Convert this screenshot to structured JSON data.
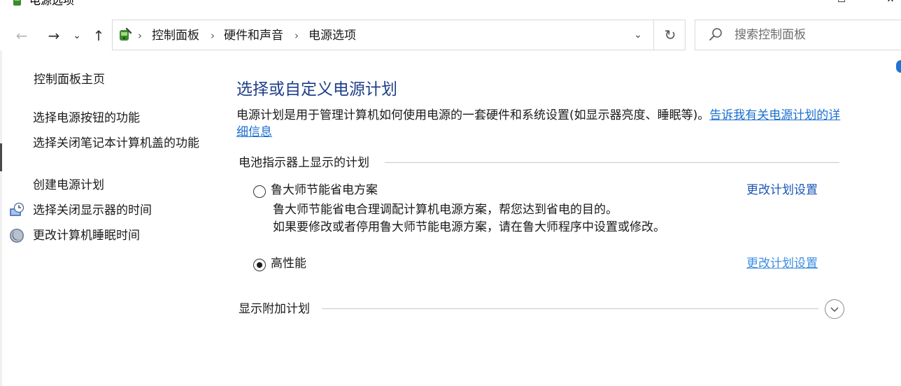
{
  "window": {
    "title": "电源选项",
    "minimize_glyph": "—",
    "maximize_glyph": "☐",
    "close_glyph": "✕"
  },
  "nav": {
    "back_glyph": "←",
    "forward_glyph": "→",
    "recent_glyph": "⌄",
    "up_glyph": "↑",
    "dropdown_glyph": "⌄",
    "refresh_glyph": "↻",
    "breadcrumb": [
      "控制面板",
      "硬件和声音",
      "电源选项"
    ],
    "separator": "›"
  },
  "search": {
    "placeholder": "搜索控制面板",
    "value": ""
  },
  "sidebar": {
    "home_label": "控制面板主页",
    "items": [
      {
        "label": "选择电源按钮的功能",
        "icon": ""
      },
      {
        "label": "选择关闭笔记本计算机盖的功能",
        "icon": ""
      },
      {
        "label": "创建电源计划",
        "icon": ""
      },
      {
        "label": "选择关闭显示器的时间",
        "icon": "monitor-clock-icon"
      },
      {
        "label": "更改计算机睡眠时间",
        "icon": "moon-icon"
      }
    ]
  },
  "main": {
    "title": "选择或自定义电源计划",
    "description": "电源计划是用于管理计算机如何使用电源的一套硬件和系统设置(如显示器亮度、睡眠等)。",
    "description_link": "告诉我有关电源计划的详细信息",
    "battery_group_label": "电池指示器上显示的计划",
    "plans": [
      {
        "name": "鲁大师节能省电方案",
        "selected": false,
        "desc_lines": [
          "鲁大师节能省电合理调配计算机电源方案，帮您达到省电的目的。",
          "如果要修改或者停用鲁大师节能电源方案，请在鲁大师程序中设置或修改。"
        ],
        "link": "更改计划设置"
      },
      {
        "name": "高性能",
        "selected": true,
        "desc_lines": [],
        "link": "更改计划设置"
      }
    ],
    "extra_plans_label": "显示附加计划"
  },
  "colors": {
    "title_blue": "#1e3f8a",
    "link_blue": "#1a6fcf",
    "link_hover": "#3c8ee0"
  }
}
